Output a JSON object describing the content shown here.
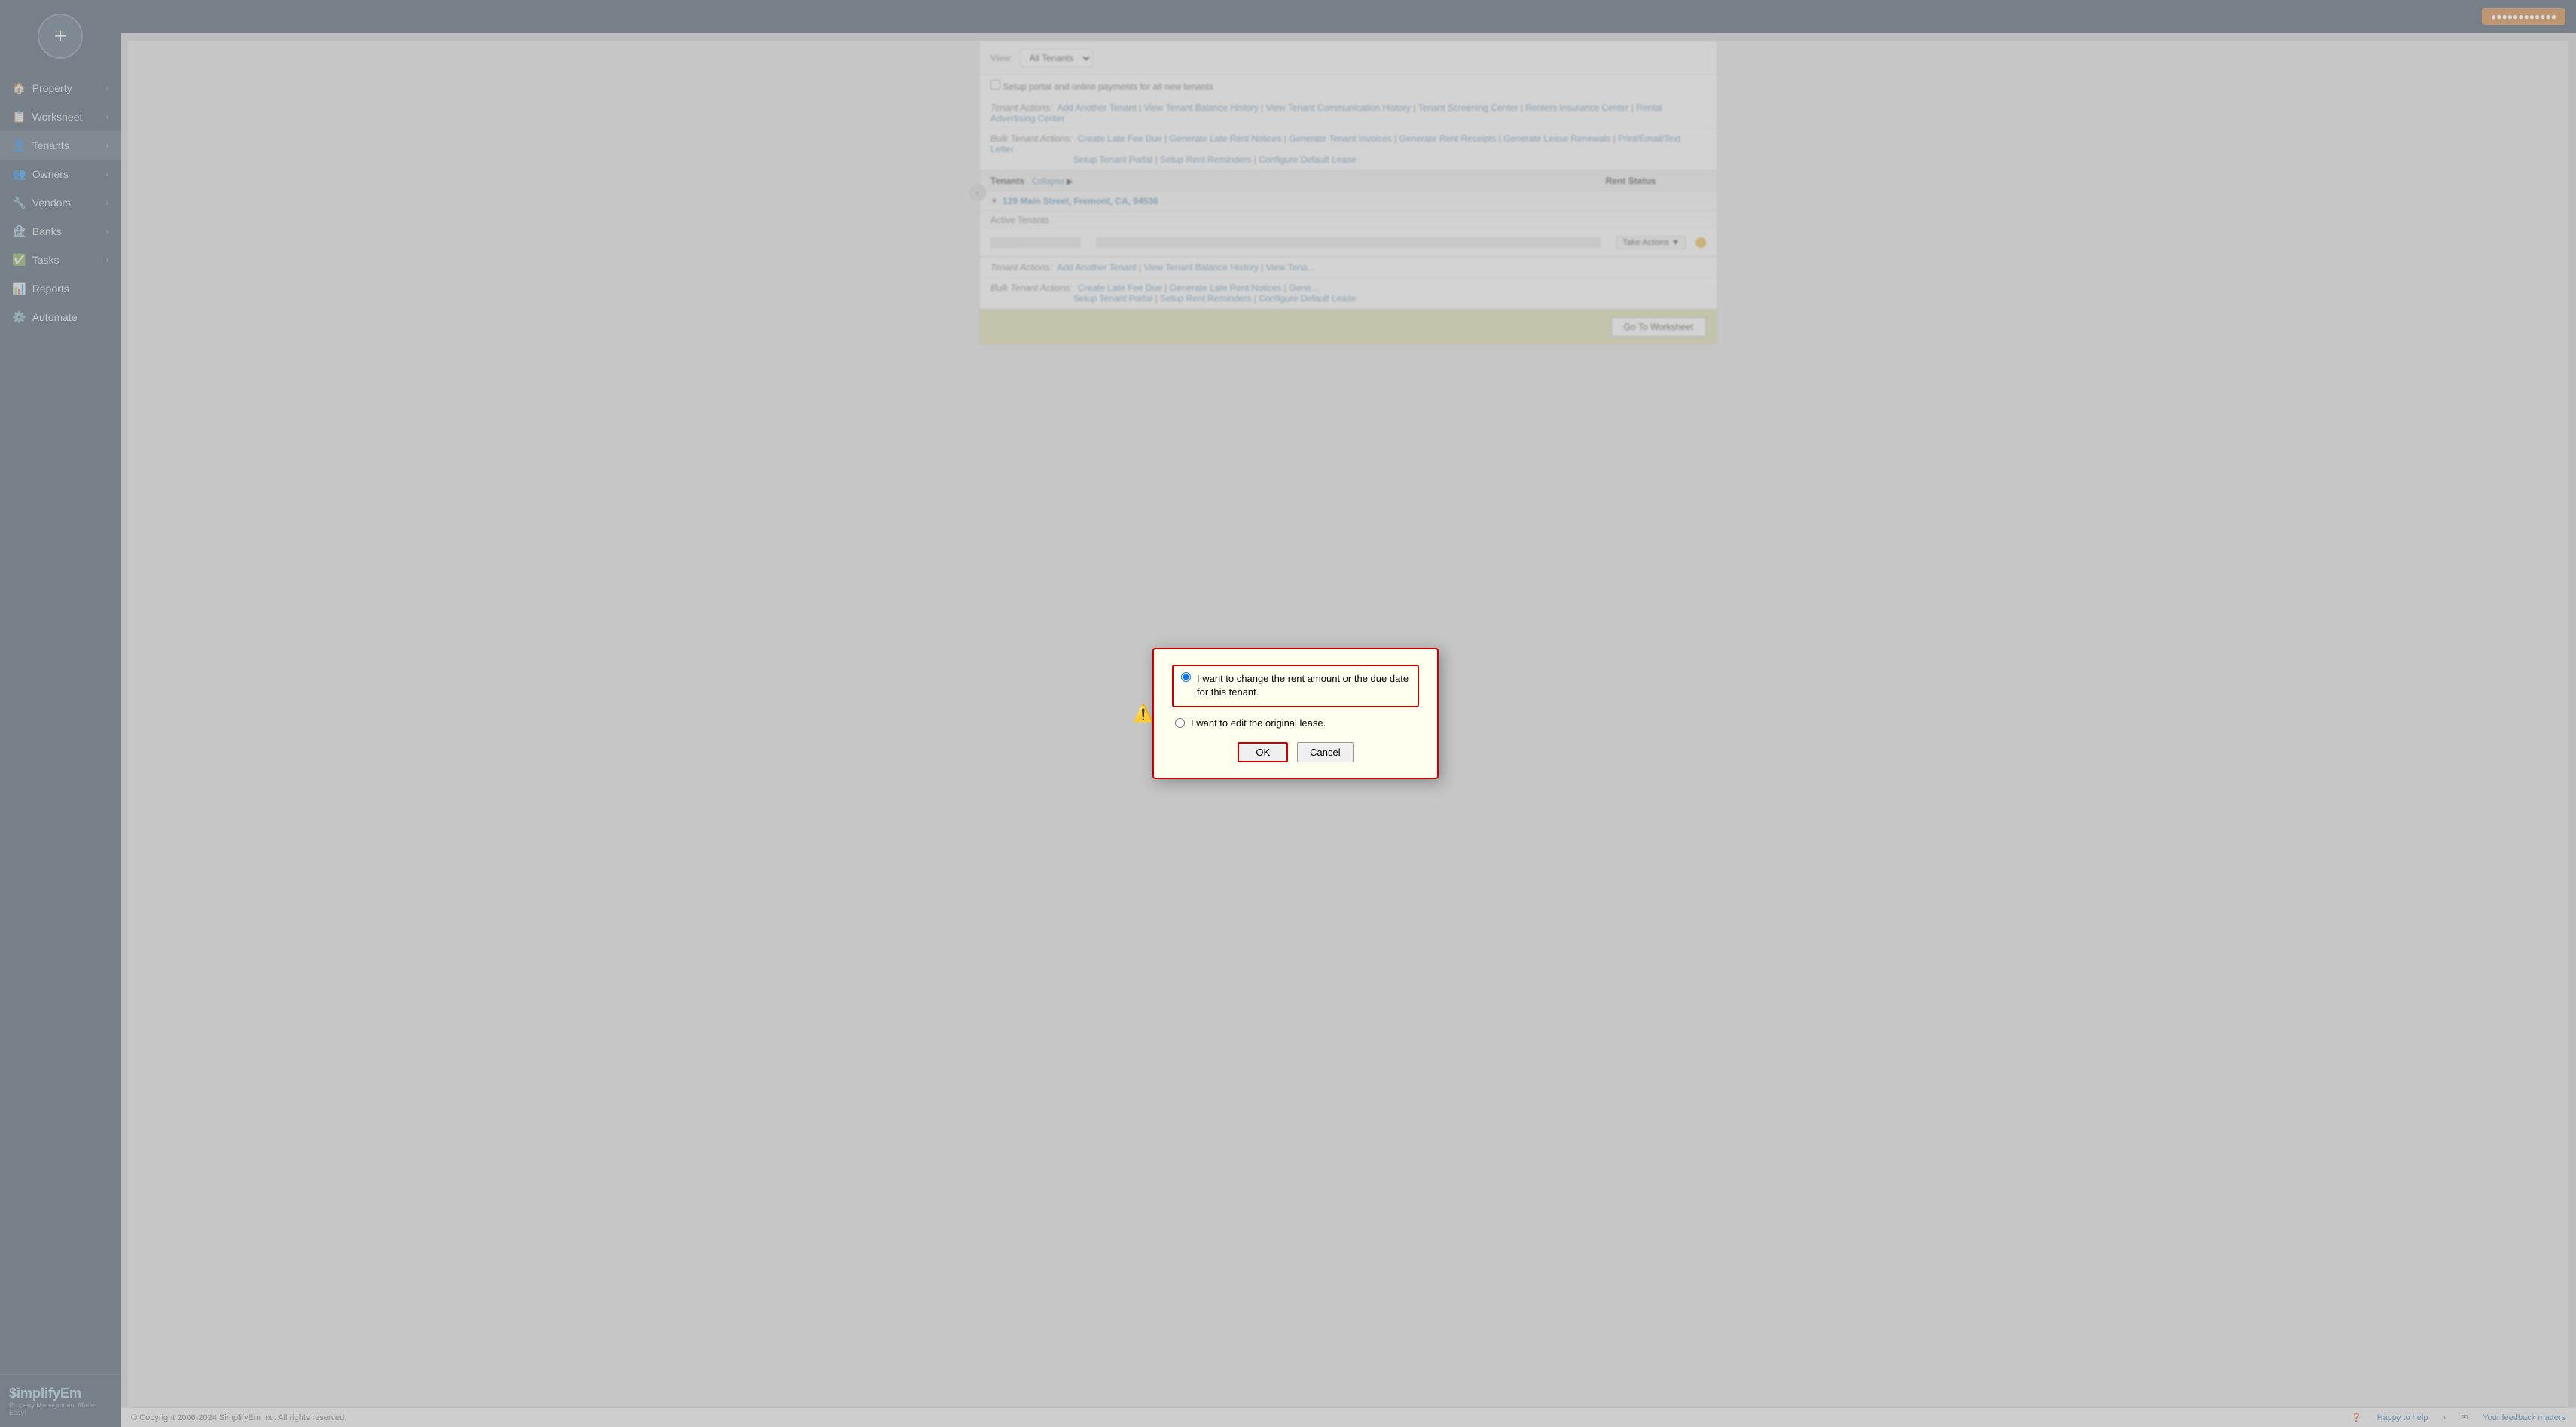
{
  "sidebar": {
    "add_button_label": "+",
    "items": [
      {
        "id": "property",
        "label": "Property",
        "icon": "🏠",
        "has_arrow": true
      },
      {
        "id": "worksheet",
        "label": "Worksheet",
        "icon": "📋",
        "has_arrow": true
      },
      {
        "id": "tenants",
        "label": "Tenants",
        "icon": "👤",
        "has_arrow": true
      },
      {
        "id": "owners",
        "label": "Owners",
        "icon": "👥",
        "has_arrow": true
      },
      {
        "id": "vendors",
        "label": "Vendors",
        "icon": "🔧",
        "has_arrow": true
      },
      {
        "id": "banks",
        "label": "Banks",
        "icon": "🏦",
        "has_arrow": true
      },
      {
        "id": "tasks",
        "label": "Tasks",
        "icon": "✅",
        "has_arrow": true
      },
      {
        "id": "reports",
        "label": "Reports",
        "icon": "📊",
        "has_arrow": false
      },
      {
        "id": "automate",
        "label": "Automate",
        "icon": "⚙️",
        "has_arrow": false
      }
    ],
    "logo_text": "$implifyEm",
    "logo_sub": "Property Management Made Easy!"
  },
  "topbar": {
    "user_label": "●●●●●●●●●●●●"
  },
  "main": {
    "view_label": "View:",
    "view_options": [
      "All Tenants"
    ],
    "view_selected": "All Tenants",
    "portal_checkbox_label": "Setup portal and online payments for all new tenants",
    "tenant_actions_label": "Tenant Actions:",
    "tenant_actions": [
      "Add Another Tenant",
      "View Tenant Balance History",
      "View Tenant Communication History",
      "Tenant Screening Center",
      "Renters Insurance Center",
      "Rental Advertising Center"
    ],
    "bulk_actions_label": "Bulk Tenant Actions:",
    "bulk_actions_row1": [
      "Create Late Fee Due",
      "Generate Late Rent Notices",
      "Generate Tenant Invoices",
      "Generate Rent Receipts",
      "Generate Lease Renewals",
      "Print/Email/Text Letter"
    ],
    "bulk_actions_row2": [
      "Setup Tenant Portal",
      "Setup Rent Reminders",
      "Configure Default Lease"
    ],
    "tenants_header": "Tenants",
    "collapse_label": "Collapse",
    "rent_status_header": "Rent Status",
    "address": "129 Main Street, Fremont, CA, 94536",
    "active_tenants_label": "Active Tenants",
    "tenant_name_blurred": "●●●●●",
    "tenant_addr_blurred": "●●●●●●●●●●",
    "take_actions_label": "Take Actions",
    "section2": {
      "tenant_actions_label": "Tenant Actions:",
      "tenant_actions": [
        "Add Another Tenant",
        "View Tenant Balance History",
        "View Tena..."
      ],
      "bulk_actions_label": "Bulk Tenant Actions:",
      "bulk_actions": [
        "Create Late Fee Due",
        "Generate Late Rent Notices",
        "Gene..."
      ],
      "bulk_actions_row2": [
        "Setup Tenant Portal",
        "Setup Rent Reminders",
        "Configure Default Lease"
      ]
    },
    "goto_worksheet_label": "Go To Worksheet"
  },
  "dialog": {
    "option1_label": "I want to change the rent amount or the due date for this tenant.",
    "option2_label": "I want to edit the original lease.",
    "ok_label": "OK",
    "cancel_label": "Cancel"
  },
  "footer": {
    "copyright": "© Copyright 2006-2024 SimplifyEm Inc. All rights reserved.",
    "help_label": "Happy to help",
    "feedback_label": "Your feedback matters"
  }
}
